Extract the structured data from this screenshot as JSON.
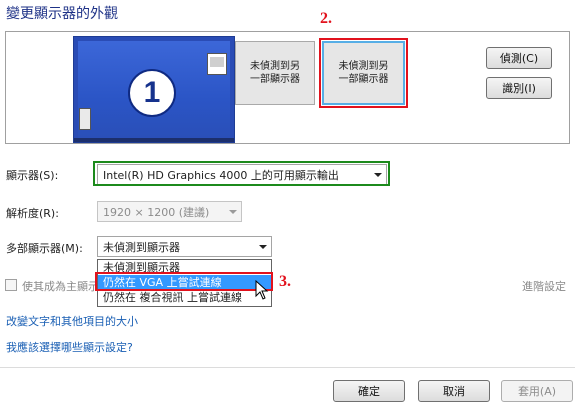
{
  "header": {
    "title": "變更顯示器的外觀"
  },
  "preview": {
    "monitor1_number": "1",
    "monitor2_label": "未偵測到另\n一部顯示器",
    "monitor3_label": "未偵測到另\n一部顯示器"
  },
  "buttons": {
    "detect": "偵測(C)",
    "identify": "識別(I)"
  },
  "annotations": {
    "step2": "2.",
    "step3": "3."
  },
  "display": {
    "label": "顯示器(S):",
    "value": "Intel(R) HD Graphics 4000 上的可用顯示輸出"
  },
  "resolution": {
    "label": "解析度(R):",
    "value": "1920 × 1200 (建議)"
  },
  "multi_display": {
    "label": "多部顯示器(M):",
    "value": "未偵測到顯示器",
    "options": [
      "未偵測到顯示器",
      "仍然在 VGA 上嘗試連線",
      "仍然在 複合視訊 上嘗試連線"
    ]
  },
  "primary": {
    "label": "使其成為主顯示"
  },
  "links": {
    "advanced": "進階設定",
    "text_size": "改變文字和其他項目的大小",
    "which_settings": "我應該選擇哪些顯示設定?"
  },
  "footer": {
    "ok": "確定",
    "cancel": "取消",
    "apply": "套用(A)"
  }
}
